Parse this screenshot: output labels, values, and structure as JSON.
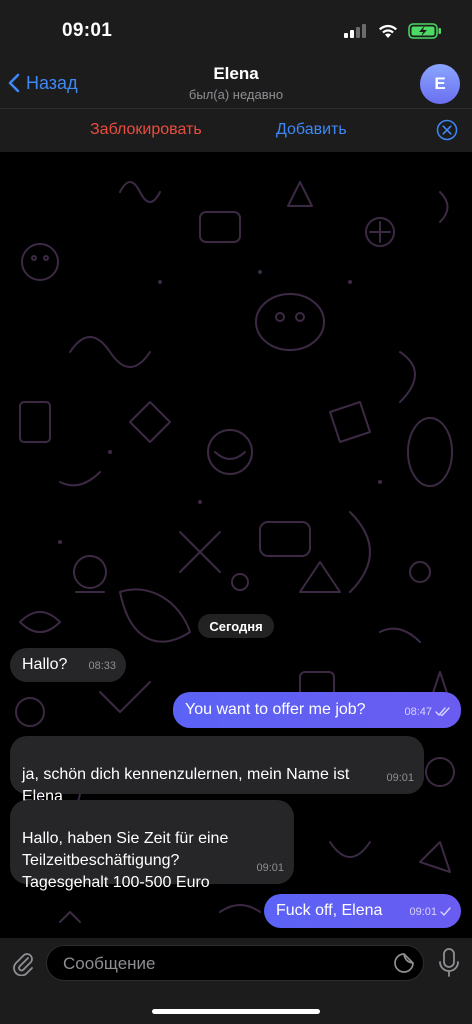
{
  "status_bar": {
    "time": "09:01"
  },
  "header": {
    "back_label": "Назад",
    "title": "Elena",
    "subtitle": "был(а) недавно",
    "avatar_letter": "E"
  },
  "action_bar": {
    "block_label": "Заблокировать",
    "add_label": "Добавить"
  },
  "chat": {
    "date_separator": "Сегодня",
    "messages": [
      {
        "direction": "incoming",
        "text": "Hallo?",
        "time": "08:33"
      },
      {
        "direction": "outgoing",
        "text": "You want to offer me job?",
        "time": "08:47",
        "status": "read"
      },
      {
        "direction": "incoming",
        "text": "ja, schön dich kennenzulernen, mein Name ist\nElena",
        "time": "09:01"
      },
      {
        "direction": "incoming",
        "text": "Hallo, haben Sie Zeit für eine\nTeilzeitbeschäftigung?\nTagesgehalt 100-500 Euro",
        "time": "09:01"
      },
      {
        "direction": "outgoing",
        "text": "Fuck off, Elena",
        "time": "09:01",
        "status": "sent"
      }
    ]
  },
  "input": {
    "placeholder": "Сообщение",
    "value": ""
  },
  "colors": {
    "accent": "#3e88f7",
    "danger": "#eb4d3d",
    "outgoing_bubble": "#5b63f6",
    "incoming_bubble": "#262628",
    "bar_background": "#1c1c1d"
  },
  "icons": [
    "signal-icon",
    "wifi-icon",
    "battery-charging-icon",
    "chevron-left-icon",
    "close-circle-icon",
    "paperclip-icon",
    "sticker-icon",
    "microphone-icon",
    "double-check-icon",
    "check-icon"
  ]
}
